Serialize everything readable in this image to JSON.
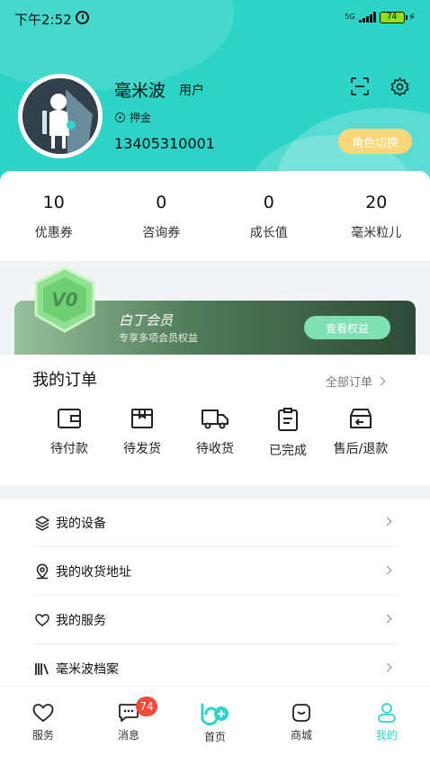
{
  "status_bar": {
    "time": "下午2:52",
    "network": "5G",
    "battery": "74"
  },
  "profile": {
    "name": "毫米波",
    "role": "用户",
    "deposit": "押金",
    "phone": "13405310001",
    "role_switch_label": "角色切换"
  },
  "stats": [
    {
      "value": "10",
      "label": "优惠券"
    },
    {
      "value": "0",
      "label": "咨询券"
    },
    {
      "value": "0",
      "label": "成长值"
    },
    {
      "value": "20",
      "label": "毫米粒儿"
    }
  ],
  "member": {
    "badge": "V0",
    "title": "白丁会员",
    "subtitle": "专享多项会员权益",
    "button_label": "查看权益"
  },
  "orders": {
    "title": "我的订单",
    "all_label": "全部订单",
    "items": [
      {
        "label": "待付款",
        "icon": "wallet-icon"
      },
      {
        "label": "待发货",
        "icon": "box-icon"
      },
      {
        "label": "待收货",
        "icon": "truck-icon"
      },
      {
        "label": "已完成",
        "icon": "clipboard-icon"
      },
      {
        "label": "售后/退款",
        "icon": "refund-icon"
      }
    ]
  },
  "menu": [
    {
      "label": "我的设备",
      "icon": "layers-icon"
    },
    {
      "label": "我的收货地址",
      "icon": "location-icon"
    },
    {
      "label": "我的服务",
      "icon": "heart-icon"
    },
    {
      "label": "毫米波档案",
      "icon": "books-icon"
    }
  ],
  "tabbar": {
    "items": [
      {
        "label": "服务",
        "icon": "heart-icon",
        "active": false
      },
      {
        "label": "消息",
        "icon": "message-icon",
        "active": false,
        "badge": "74"
      },
      {
        "label": "首页",
        "icon": "home-icon",
        "active": false
      },
      {
        "label": "商城",
        "icon": "shop-icon",
        "active": false
      },
      {
        "label": "我的",
        "icon": "user-icon",
        "active": true
      }
    ]
  },
  "colors": {
    "brand": "#2ed3c7",
    "role_switch": "#f8d77a",
    "badge": "#f5493b",
    "member_button": "#7ee0b4"
  }
}
